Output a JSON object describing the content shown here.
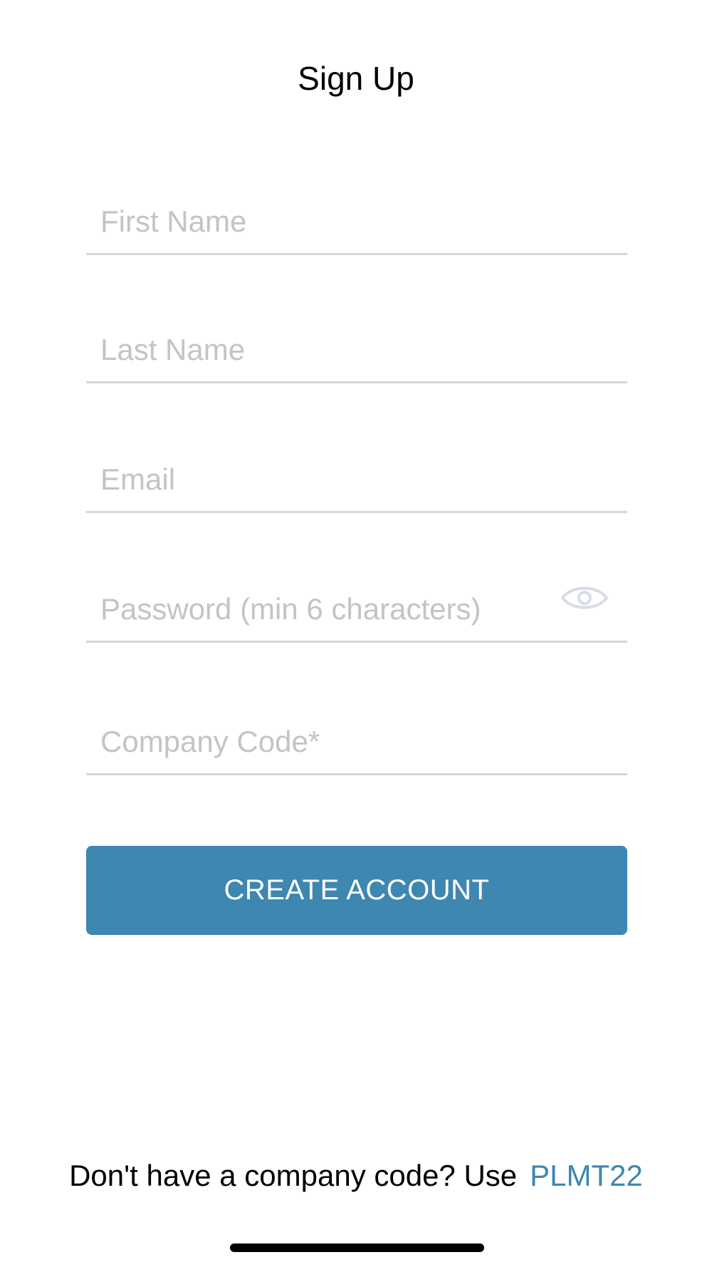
{
  "header": {
    "title": "Sign Up"
  },
  "form": {
    "first_name": {
      "placeholder": "First Name",
      "value": ""
    },
    "last_name": {
      "placeholder": "Last Name",
      "value": ""
    },
    "email": {
      "placeholder": "Email",
      "value": ""
    },
    "password": {
      "placeholder": "Password (min 6 characters)",
      "value": "",
      "toggle_icon": "eye-icon"
    },
    "company_code": {
      "placeholder": "Company Code*",
      "value": ""
    },
    "submit_label": "CREATE ACCOUNT"
  },
  "footer": {
    "message": "Don't have a company code? Use",
    "code_link": "PLMT22"
  },
  "colors": {
    "accent": "#3d87b0",
    "placeholder": "#c3c3c8",
    "divider": "#d6d6d6",
    "eye_icon": "#d8dbe8"
  }
}
